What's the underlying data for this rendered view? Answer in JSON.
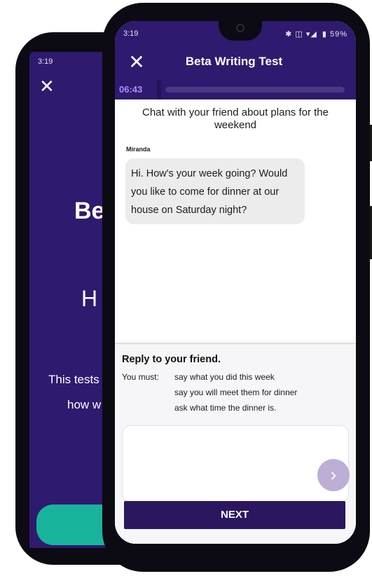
{
  "back_screen": {
    "time": "3:19",
    "close_icon": "close-icon",
    "title": "Be",
    "subtitle": "H",
    "body_line1": "This tests",
    "body_line2": "how w",
    "button_color": "#19b39b"
  },
  "status_bar": {
    "time": "3:19",
    "icons": "✱ ◫ ▾◢",
    "battery": "▮ 59%"
  },
  "header": {
    "title": "Beta Writing Test",
    "close_label": "✕",
    "background": "#2e1a6e"
  },
  "timer": {
    "value": "06:43",
    "progress": 0.0
  },
  "chat": {
    "prompt": "Chat with your friend about plans for the weekend",
    "messages": [
      {
        "sender": "Miranda",
        "text": "Hi. How's your week going? Would you like to come for dinner at our house on Saturday night?"
      }
    ]
  },
  "task": {
    "title": "Reply to your friend.",
    "must_label": "You must:",
    "requirements": [
      "say what you did this week",
      "say you will meet them for dinner",
      "ask what time the dinner is."
    ],
    "reply_value": ""
  },
  "send_button": {
    "label": "›",
    "icon": "chevron-right-icon"
  },
  "next_button": {
    "label": "NEXT"
  }
}
